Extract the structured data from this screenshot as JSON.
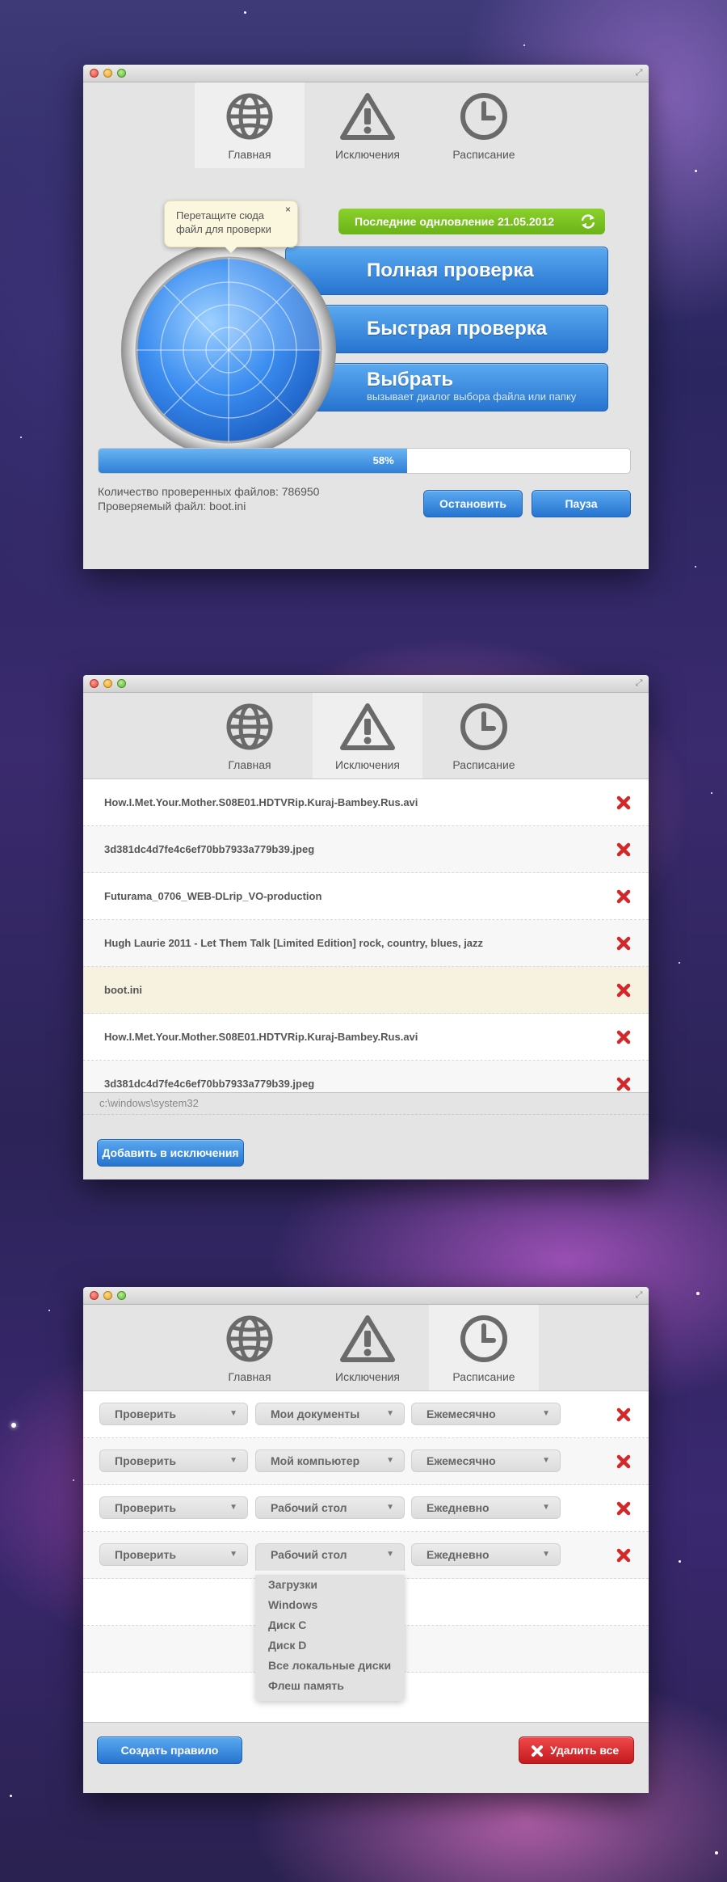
{
  "tabs": {
    "main": "Главная",
    "exclusions": "Исключения",
    "schedule": "Расписание"
  },
  "main": {
    "tooltip": [
      "Перетащите сюда",
      "файл для проверки"
    ],
    "tooltip_close": "×",
    "last_update": "Последние однловление 21.05.2012",
    "full_scan": "Полная проверка",
    "quick_scan": "Быстрая проверка",
    "choose": "Выбрать",
    "choose_sub": "вызывает диалог выбора файла или папку",
    "progress": 0.58,
    "progress_label": "58%",
    "files_checked": "Количество проверенных файлов: 786950",
    "current_file": "Проверяемый файл: boot.ini",
    "stop_button": "Остановить",
    "pause_button": "Пауза"
  },
  "exclusions": {
    "items": [
      "How.I.Met.Your.Mother.S08E01.HDTVRip.Kuraj-Bambey.Rus.avi",
      "3d381dc4d7fe4c6ef70bb7933a779b39.jpeg",
      "Futurama_0706_WEB-DLrip_VO-production",
      "Hugh Laurie 2011 - Let Them Talk [Limited Edition] rock, country, blues, jazz",
      "boot.ini",
      "How.I.Met.Your.Mother.S08E01.HDTVRip.Kuraj-Bambey.Rus.avi",
      "3d381dc4d7fe4c6ef70bb7933a779b39.jpeg"
    ],
    "path": "c:\\windows\\system32",
    "add_button": "Добавить в исключения"
  },
  "schedule": {
    "rules": [
      {
        "action": "Проверить",
        "target": "Мои документы",
        "period": "Ежемесячно"
      },
      {
        "action": "Проверить",
        "target": "Мой компьютер",
        "period": "Ежемесячно"
      },
      {
        "action": "Проверить",
        "target": "Рабочий стол",
        "period": "Ежедневно"
      },
      {
        "action": "Проверить",
        "target": "Рабочий стол",
        "period": "Ежедневно"
      }
    ],
    "dropdown_options": [
      "Загрузки",
      "Windows",
      "Диск C",
      "Диск D",
      "Все локальные диски",
      "Флеш память"
    ],
    "create_button": "Создать правило",
    "delete_all_button": "Удалить все"
  },
  "colors": {
    "blue": "#2f7fd6",
    "green": "#6bb317",
    "red": "#d4272a",
    "highlight": "#f7f1df"
  },
  "icons": [
    "globe-icon",
    "warning-icon",
    "clock-icon",
    "refresh-icon",
    "close-icon",
    "radar-icon"
  ]
}
